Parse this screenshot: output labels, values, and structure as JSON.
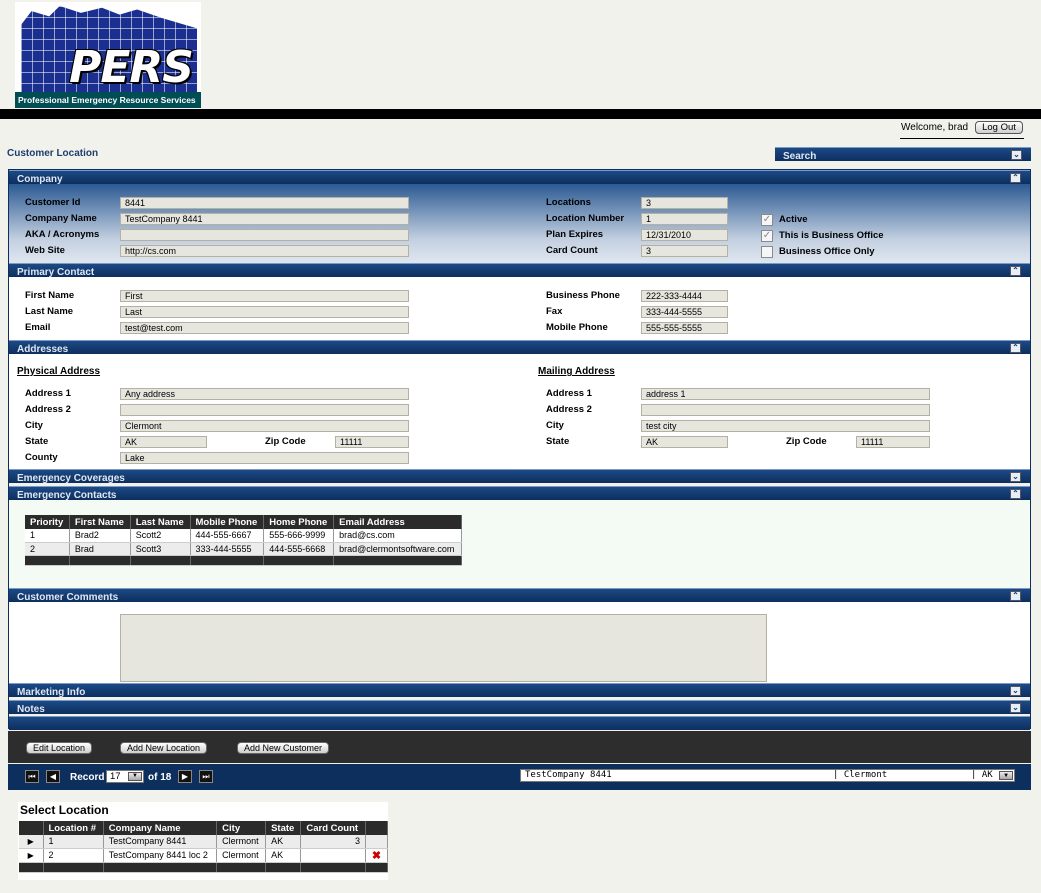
{
  "logo": {
    "text": "PERS",
    "tagline": "Professional Emergency Resource Services"
  },
  "header": {
    "welcome": "Welcome, brad",
    "logout": "Log Out"
  },
  "page": {
    "title": "Customer Location",
    "search": "Search"
  },
  "company": {
    "section": "Company",
    "customer_id_label": "Customer Id",
    "customer_id": "8441",
    "company_name_label": "Company Name",
    "company_name": "TestCompany 8441",
    "aka_label": "AKA / Acronyms",
    "aka": "",
    "website_label": "Web Site",
    "website": "http://cs.com",
    "locations_label": "Locations",
    "locations": "3",
    "location_number_label": "Location Number",
    "location_number": "1",
    "plan_expires_label": "Plan Expires",
    "plan_expires": "12/31/2010",
    "card_count_label": "Card Count",
    "card_count": "3",
    "active_label": "Active",
    "business_office_label": "This is Business Office",
    "business_office_only_label": "Business Office Only",
    "active": true,
    "business_office": true,
    "business_office_only": false
  },
  "contact": {
    "section": "Primary Contact",
    "first_label": "First Name",
    "first": "First",
    "last_label": "Last Name",
    "last": "Last",
    "email_label": "Email",
    "email": "test@test.com",
    "bphone_label": "Business Phone",
    "bphone": "222-333-4444",
    "fax_label": "Fax",
    "fax": "333-444-5555",
    "mphone_label": "Mobile Phone",
    "mphone": "555-555-5555"
  },
  "addresses": {
    "section": "Addresses",
    "phys_title": "Physical Address",
    "mail_title": "Mailing Address",
    "addr1_label": "Address 1",
    "addr2_label": "Address 2",
    "city_label": "City",
    "state_label": "State",
    "zip_label": "Zip Code",
    "county_label": "County",
    "phys": {
      "addr1": "Any address",
      "addr2": "",
      "city": "Clermont",
      "state": "AK",
      "zip": "11111",
      "county": "Lake"
    },
    "mail": {
      "addr1": "address 1",
      "addr2": "",
      "city": "test city",
      "state": "AK",
      "zip": "11111"
    }
  },
  "sections": {
    "coverages": "Emergency Coverages",
    "contacts": "Emergency Contacts",
    "comments": "Customer Comments",
    "marketing": "Marketing Info",
    "notes": "Notes"
  },
  "contacts_table": {
    "headers": [
      "Priority",
      "First Name",
      "Last Name",
      "Mobile Phone",
      "Home Phone",
      "Email Address"
    ],
    "rows": [
      [
        "1",
        "Brad2",
        "Scott2",
        "444-555-6667",
        "555-666-9999",
        "brad@cs.com"
      ],
      [
        "2",
        "Brad",
        "Scott3",
        "333-444-5555",
        "444-555-6668",
        "brad@clermontsoftware.com"
      ]
    ]
  },
  "buttons": {
    "edit": "Edit Location",
    "add_loc": "Add New Location",
    "add_cust": "Add New Customer"
  },
  "nav": {
    "record_label": "Record",
    "record": "17",
    "of": "of 18",
    "combo_company": "TestCompany 8441",
    "combo_city": "| Clermont",
    "combo_state": "| AK"
  },
  "select_location": {
    "title": "Select Location",
    "headers": [
      "Location #",
      "Company Name",
      "City",
      "State",
      "Card Count"
    ],
    "rows": [
      [
        "1",
        "TestCompany 8441",
        "Clermont",
        "AK",
        "3"
      ],
      [
        "2",
        "TestCompany 8441 loc 2",
        "Clermont",
        "AK",
        ""
      ]
    ]
  },
  "icons": {
    "collapse": "collapse-icon",
    "expand": "expand-icon",
    "delete": "delete-icon"
  }
}
